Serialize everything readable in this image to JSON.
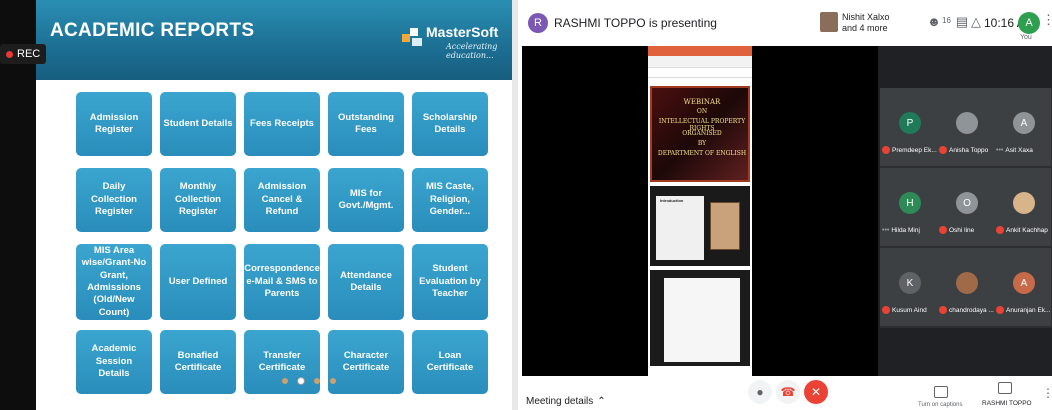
{
  "slide": {
    "rec_label": "REC",
    "title": "ACADEMIC REPORTS",
    "logo_name": "MasterSoft",
    "logo_tagline": "Accelerating education...",
    "tiles": [
      "Admission Register",
      "Student Details",
      "Fees Receipts",
      "Outstanding Fees",
      "Scholarship Details",
      "Daily Collection Register",
      "Monthly Collection Register",
      "Admission Cancel & Refund",
      "MIS for Govt./Mgmt.",
      "MIS Caste, Religion, Gender...",
      "MIS Area wise/Grant-No Grant, Admissions (Old/New Count)",
      "User Defined",
      "Correspondence e-Mail & SMS to Parents",
      "Attendance Details",
      "Student Evaluation by Teacher",
      "Academic Session Details",
      "Bonafied Certificate",
      "Transfer Certificate",
      "Character Certificate",
      "Loan Certificate"
    ],
    "pager_active": 1,
    "pager_count": 4
  },
  "meet": {
    "presenter_initial": "R",
    "presenting_text": "RASHMI TOPPO is presenting",
    "more_people": [
      "Nishit Xalxo",
      "and 4 more"
    ],
    "participant_count": "16",
    "clock": "10:16 AM",
    "self_initial": "A",
    "self_label": "You",
    "shared_doc": {
      "lines": [
        "WEBINAR",
        "ON",
        "INTELLECTUAL PROPERTY RIGHTS",
        "ORGANISED",
        "BY",
        "DEPARTMENT OF ENGLISH"
      ],
      "intro": "Introduction"
    },
    "participants": [
      {
        "initial": "P",
        "name": "Premdeep Ek...",
        "color": "#1f7a5a",
        "muted": true
      },
      {
        "initial": "",
        "name": "Anisha Toppo",
        "color": "#8f9499",
        "muted": true
      },
      {
        "initial": "A",
        "name": "Asit Xaxa",
        "color": "#8f9499",
        "muted": false
      },
      {
        "initial": "H",
        "name": "Hilda Minj",
        "color": "#2e8b57",
        "muted": false
      },
      {
        "initial": "O",
        "name": "Oshi line",
        "color": "#8f9499",
        "muted": true
      },
      {
        "initial": "",
        "name": "Ankit Kachhap",
        "color": "#d8b48a",
        "muted": true
      },
      {
        "initial": "K",
        "name": "Kusum Aind",
        "color": "#5f6368",
        "muted": true
      },
      {
        "initial": "",
        "name": "chandrodaya ...",
        "color": "#a06a48",
        "muted": true
      },
      {
        "initial": "A",
        "name": "Anuranjan Ek...",
        "color": "#c66a4a",
        "muted": true
      }
    ],
    "meeting_details": "Meeting details",
    "present_label": "Turn on captions",
    "rashmi_label": "RASHMI TOPPO"
  }
}
